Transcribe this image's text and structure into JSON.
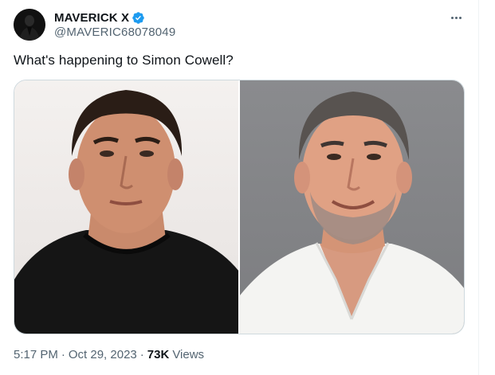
{
  "author": {
    "display_name": "MAVERICK X",
    "handle": "@MAVERIC68078049",
    "verified": true
  },
  "tweet": {
    "text": "What's happening to Simon Cowell?",
    "time": "5:17 PM",
    "date": "Oct 29, 2023",
    "separator": "·",
    "views_count": "73K",
    "views_label": "Views"
  },
  "media": {
    "count": 2,
    "left_photo": "young man with dark hair in black t-shirt on light background",
    "right_photo": "older man with grey hair and beard in white shirt on grey background"
  },
  "icons": {
    "verified": "verified-badge-icon",
    "more": "more-options-icon"
  },
  "colors": {
    "primary_text": "#0f1419",
    "secondary_text": "#536471",
    "verified_blue": "#1d9bf0",
    "border": "#cfd9de"
  }
}
